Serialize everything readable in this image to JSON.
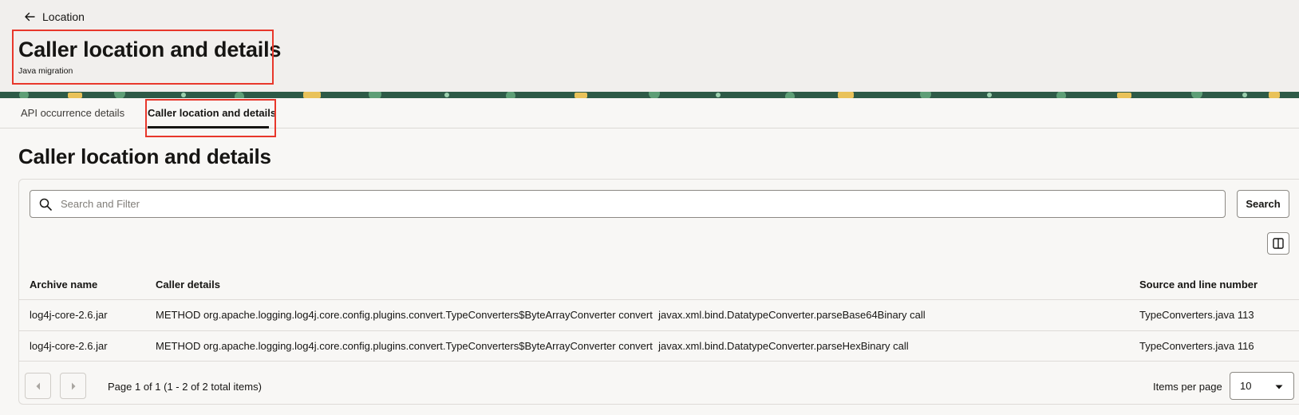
{
  "header": {
    "back_label": "Location",
    "title": "Caller location and details",
    "subtitle": "Java migration"
  },
  "tabs": [
    {
      "label": "API occurrence details",
      "active": false
    },
    {
      "label": "Caller location and details",
      "active": true
    }
  ],
  "section": {
    "title": "Caller location and details"
  },
  "search": {
    "placeholder": "Search and Filter",
    "button_label": "Search"
  },
  "table": {
    "columns": [
      "Archive name",
      "Caller details",
      "Source and line number"
    ],
    "rows": [
      {
        "archive": "log4j-core-2.6.jar",
        "caller": "METHOD org.apache.logging.log4j.core.config.plugins.convert.TypeConverters$ByteArrayConverter convert  javax.xml.bind.DatatypeConverter.parseBase64Binary call",
        "source": "TypeConverters.java 113"
      },
      {
        "archive": "log4j-core-2.6.jar",
        "caller": "METHOD org.apache.logging.log4j.core.config.plugins.convert.TypeConverters$ByteArrayConverter convert  javax.xml.bind.DatatypeConverter.parseHexBinary call",
        "source": "TypeConverters.java 116"
      }
    ]
  },
  "pagination": {
    "summary": "Page 1 of 1 (1 - 2 of 2 total items)",
    "items_per_page_label": "Items per page",
    "items_per_page_value": "10"
  },
  "icons": {
    "back": "arrow-left-icon",
    "search": "search-icon",
    "columns": "column-layout-icon",
    "prev": "chevron-left-icon",
    "next": "chevron-right-icon",
    "select": "caret-down-icon"
  },
  "colors": {
    "highlight": "#e8372b",
    "banner": "#2e5a47",
    "text": "#161513"
  }
}
